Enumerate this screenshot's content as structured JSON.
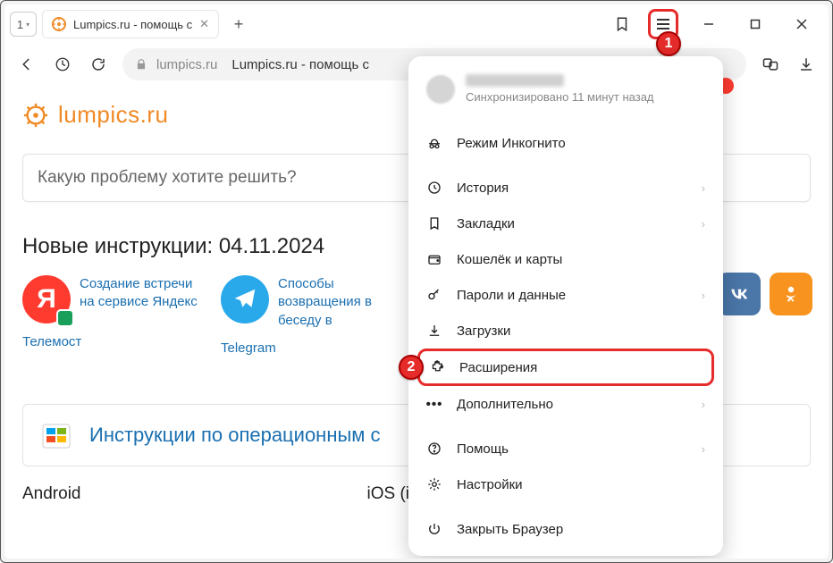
{
  "tabbar": {
    "tab_count": "1",
    "tab_title": "Lumpics.ru - помощь с"
  },
  "addrbar": {
    "domain": "lumpics.ru",
    "title": "Lumpics.ru - помощь с"
  },
  "page": {
    "logo_text": "lumpics.ru",
    "search_placeholder": "Какую проблему хотите решить?",
    "section_head": "Новые инструкции: 04.11.2024",
    "card1_title": "Создание встречи на сервисе Яндекс",
    "card1_sub": "Телемост",
    "card2_title": "Способы возвращения в беседу в",
    "card2_sub": "Telegram",
    "os_band": "Инструкции по операционным с",
    "platform1": "Android",
    "platform2": "iOS (iPhone, iPad)"
  },
  "menu": {
    "sync_status": "Синхронизировано 11 минут назад",
    "incognito": "Режим Инкогнито",
    "history": "История",
    "bookmarks": "Закладки",
    "wallet": "Кошелёк и карты",
    "passwords": "Пароли и данные",
    "downloads": "Загрузки",
    "extensions": "Расширения",
    "more": "Дополнительно",
    "help": "Помощь",
    "settings": "Настройки",
    "close": "Закрыть Браузер"
  },
  "callouts": {
    "one": "1",
    "two": "2"
  }
}
